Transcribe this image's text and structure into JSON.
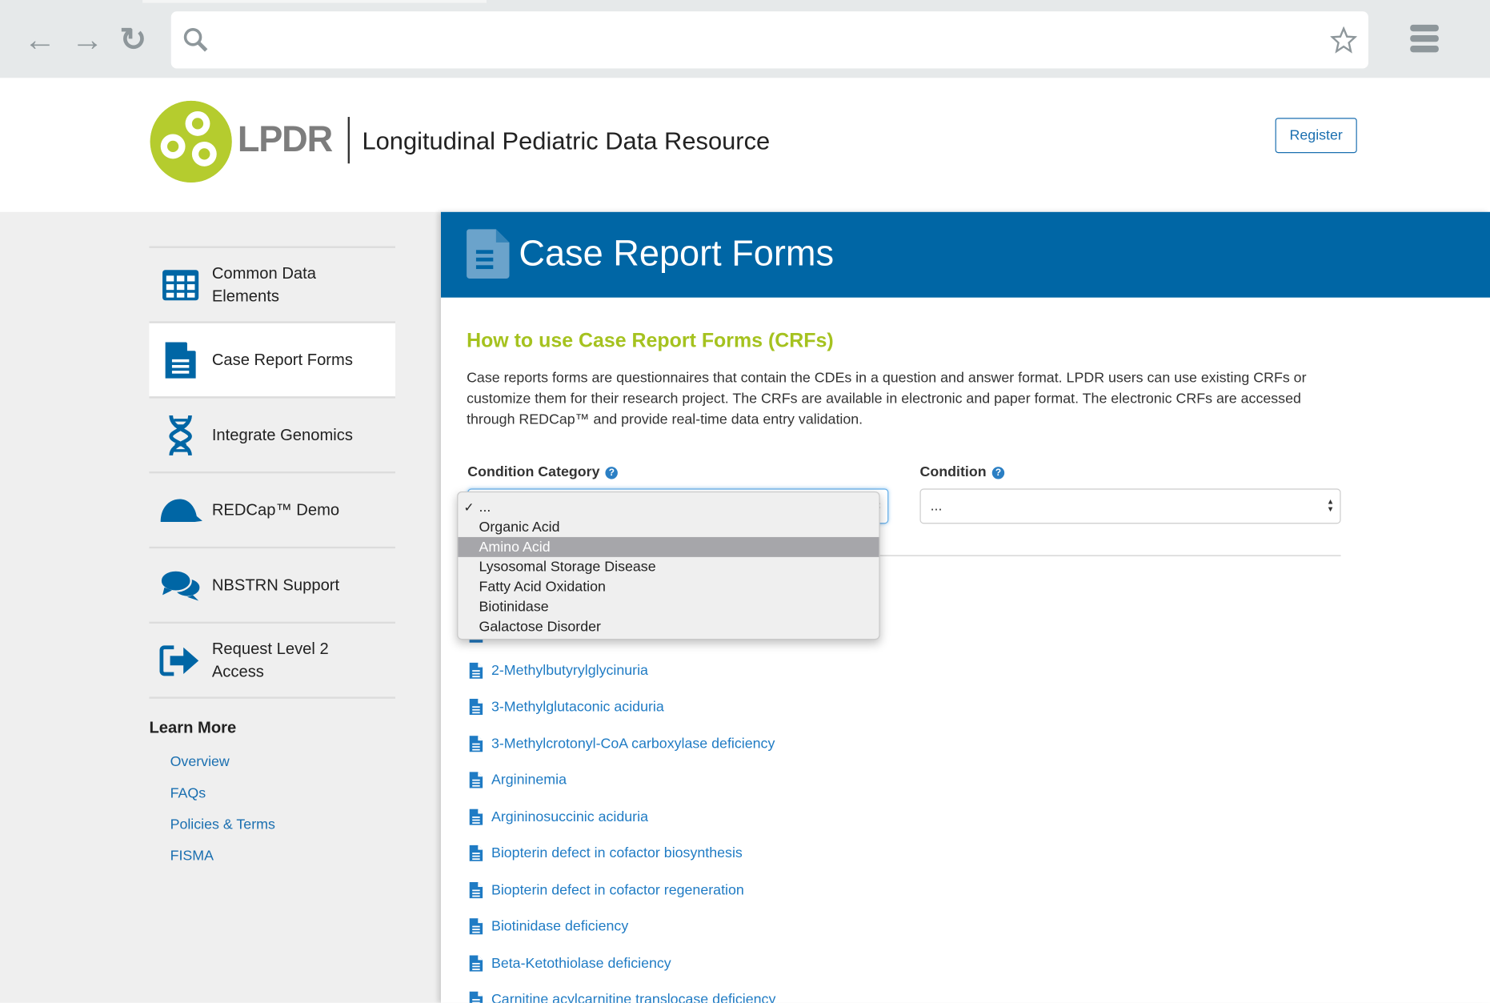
{
  "browser": {
    "back_icon": "arrow-left",
    "forward_icon": "arrow-right",
    "reload_icon": "reload",
    "search_icon": "search",
    "bookmark_icon": "star",
    "menu_icon": "hamburger",
    "address_value": ""
  },
  "header": {
    "logo_text": "LPDR",
    "site_title": "Longitudinal Pediatric Data Resource",
    "register_label": "Register"
  },
  "sidebar": {
    "items": [
      {
        "label": "Common Data Elements",
        "icon": "table-grid"
      },
      {
        "label": "Case Report Forms",
        "icon": "document",
        "active": true
      },
      {
        "label": "Integrate Genomics",
        "icon": "dna"
      },
      {
        "label": "REDCap™ Demo",
        "icon": "cap"
      },
      {
        "label": "NBSTRN Support",
        "icon": "chat-bubbles"
      },
      {
        "label": "Request Level 2 Access",
        "icon": "sign-in"
      }
    ],
    "learn_more": {
      "title": "Learn More",
      "links": [
        "Overview",
        "FAQs",
        "Policies & Terms",
        "FISMA"
      ]
    }
  },
  "main": {
    "banner_title": "Case Report Forms",
    "heading": "How to use Case Report Forms (CRFs)",
    "paragraph": "Case reports forms are questionnaires that contain the CDEs in a question and answer format. LPDR users can use existing CRFs or customize them for their research project. The CRFs are available in electronic and paper format. The electronic CRFs are accessed through REDCap™ and provide real-time data entry validation.",
    "condition_category": {
      "label": "Condition Category",
      "value": "...",
      "options": [
        "...",
        "Organic Acid",
        "Amino Acid",
        "Lysosomal Storage Disease",
        "Fatty Acid Oxidation",
        "Biotinidase",
        "Galactose Disorder"
      ],
      "checked": "...",
      "highlighted": "Amino Acid"
    },
    "condition": {
      "label": "Condition",
      "value": "..."
    },
    "forms": [
      "2-Methylbutyrylglycinuria",
      "3-Methylglutaconic aciduria",
      "3-Methylcrotonyl-CoA carboxylase deficiency",
      "Argininemia",
      "Argininosuccinic aciduria",
      "Biopterin defect in cofactor biosynthesis",
      "Biopterin defect in cofactor regeneration",
      "Biotinidase deficiency",
      "Beta-Ketothiolase deficiency",
      "Carnitine acylcarnitine translocase deficiency"
    ]
  },
  "colors": {
    "brand_blue": "#0066a5",
    "brand_green": "#b5cc2e",
    "link_blue": "#1f7bc4",
    "heading_green": "#a5c21f"
  }
}
